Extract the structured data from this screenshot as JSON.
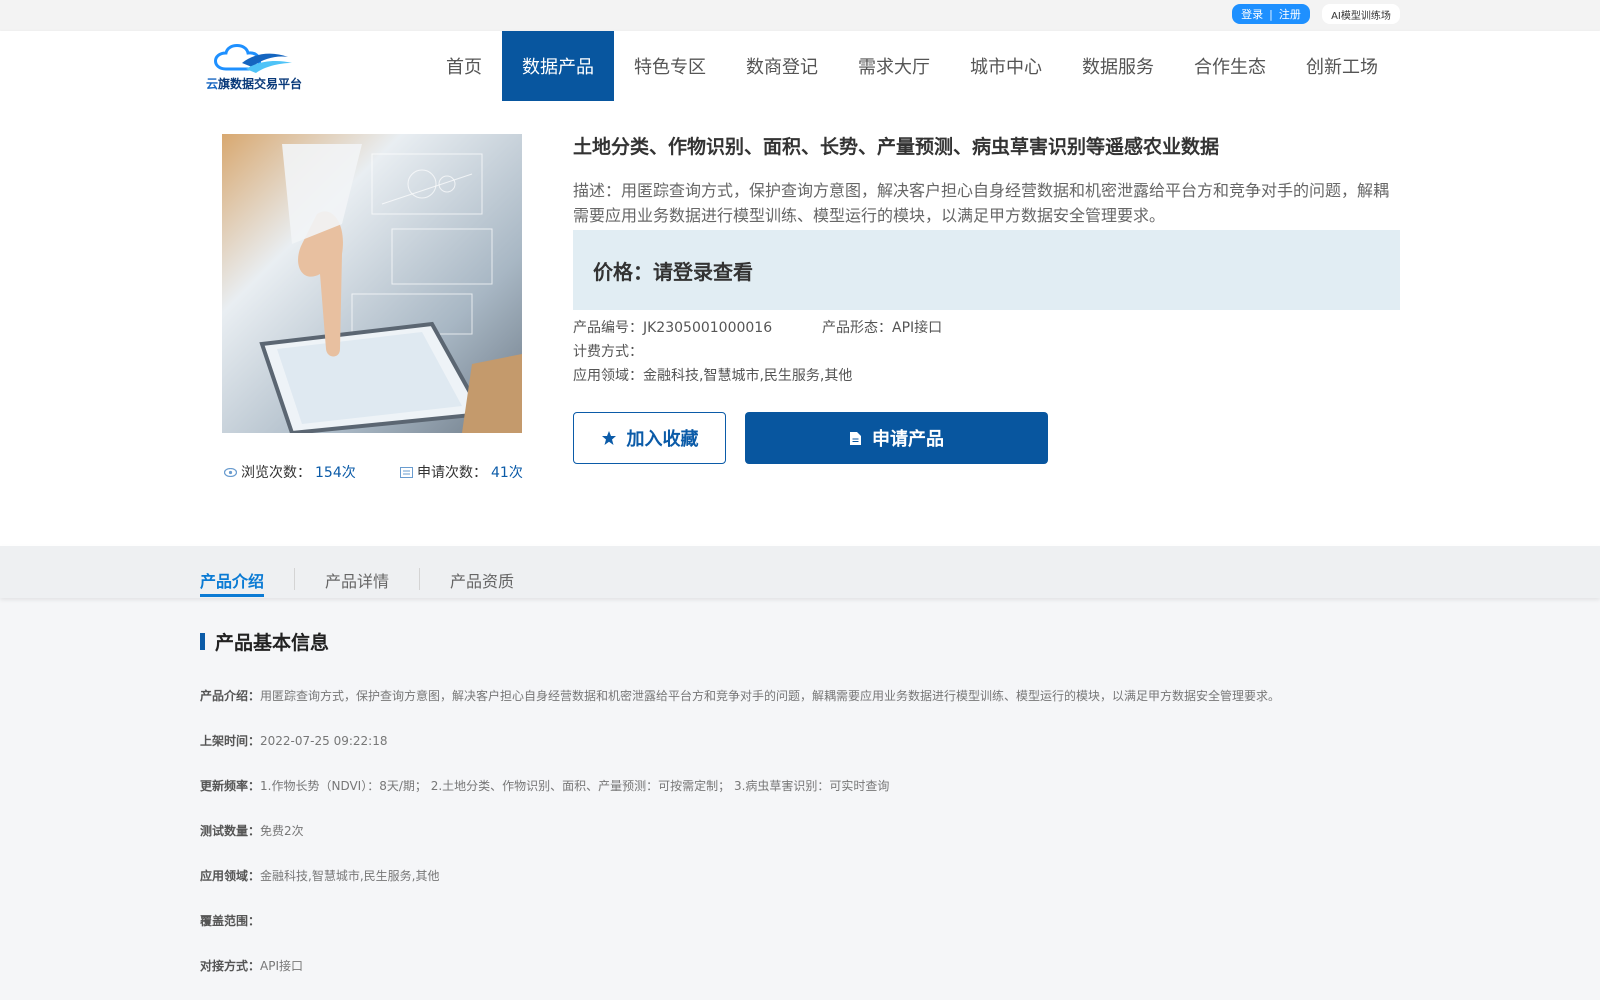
{
  "topbar": {
    "login": "登录",
    "divider": "|",
    "register": "注册",
    "ai_link": "AI模型训练场"
  },
  "logo": {
    "text_part1": "云",
    "text_part2": "旗",
    "text_part3": "数据交易平台"
  },
  "nav": [
    {
      "label": "首页",
      "active": false
    },
    {
      "label": "数据产品",
      "active": true
    },
    {
      "label": "特色专区",
      "active": false
    },
    {
      "label": "数商登记",
      "active": false
    },
    {
      "label": "需求大厅",
      "active": false
    },
    {
      "label": "城市中心",
      "active": false
    },
    {
      "label": "数据服务",
      "active": false
    },
    {
      "label": "合作生态",
      "active": false
    },
    {
      "label": "创新工场",
      "active": false
    }
  ],
  "product": {
    "title": "土地分类、作物识别、面积、长势、产量预测、病虫草害识别等遥感农业数据",
    "description": "描述：用匿踪查询方式，保护查询方意图，解决客户担心自身经营数据和机密泄露给平台方和竞争对手的问题，解耦需要应用业务数据进行模型训练、模型运行的模块，以满足甲方数据安全管理要求。",
    "price": "价格：请登录查看",
    "code": "产品编号：JK2305001000016",
    "form": "产品形态：API接口",
    "billing": "计费方式：",
    "domain": "应用领域：金融科技,智慧城市,民生服务,其他",
    "fav_button": "加入收藏",
    "apply_button": "申请产品",
    "views_label": "浏览次数：",
    "views_value": "154次",
    "applies_label": "申请次数：",
    "applies_value": "41次"
  },
  "tabs": [
    "产品介绍",
    "产品详情",
    "产品资质"
  ],
  "section": {
    "title": "产品基本信息",
    "rows": [
      {
        "key": "产品介绍：",
        "value": "用匿踪查询方式，保护查询方意图，解决客户担心自身经营数据和机密泄露给平台方和竞争对手的问题，解耦需要应用业务数据进行模型训练、模型运行的模块，以满足甲方数据安全管理要求。"
      },
      {
        "key": "上架时间：",
        "value": "2022-07-25 09:22:18"
      },
      {
        "key": "更新频率：",
        "value": "1.作物长势（NDVI）：8天/期； 2.土地分类、作物识别、面积、产量预测：可按需定制； 3.病虫草害识别：可实时查询"
      },
      {
        "key": "测试数量：",
        "value": "免费2次"
      },
      {
        "key": "应用领域：",
        "value": "金融科技,智慧城市,民生服务,其他"
      },
      {
        "key": "覆盖范围：",
        "value": ""
      },
      {
        "key": "对接方式：",
        "value": "API接口"
      }
    ]
  },
  "colors": {
    "primary": "#08569f",
    "accent_blue": "#0b7bd4",
    "price_bg": "#e1edf3"
  }
}
